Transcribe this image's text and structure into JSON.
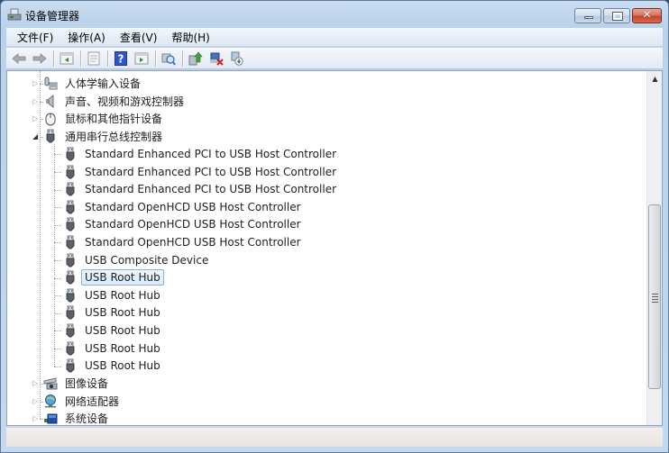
{
  "window": {
    "title": "设备管理器",
    "icon": "device-manager-icon",
    "controls": {
      "minimize": "minimize",
      "maximize": "maximize",
      "close": "✕"
    }
  },
  "menubar": {
    "items": [
      {
        "label": "文件(F)"
      },
      {
        "label": "操作(A)"
      },
      {
        "label": "查看(V)"
      },
      {
        "label": "帮助(H)"
      }
    ]
  },
  "toolbar": {
    "buttons": [
      {
        "icon": "back-arrow-icon"
      },
      {
        "icon": "forward-arrow-icon"
      },
      {
        "icon": "show-hide-console-tree-icon"
      },
      {
        "icon": "properties-icon"
      },
      {
        "icon": "help-icon"
      },
      {
        "icon": "show-hide-action-pane-icon"
      },
      {
        "icon": "scan-hardware-changes-icon"
      },
      {
        "icon": "update-driver-icon"
      },
      {
        "icon": "uninstall-device-icon"
      },
      {
        "icon": "disable-device-icon"
      }
    ]
  },
  "tree": {
    "nodes": [
      {
        "label": "人体学输入设备",
        "icon": "hid-icon",
        "expanded": false,
        "level": 0
      },
      {
        "label": "声音、视频和游戏控制器",
        "icon": "speaker-icon",
        "expanded": false,
        "level": 0
      },
      {
        "label": "鼠标和其他指针设备",
        "icon": "mouse-icon",
        "expanded": false,
        "level": 0
      },
      {
        "label": "通用串行总线控制器",
        "icon": "usb-icon",
        "expanded": true,
        "level": 0
      },
      {
        "label": "Standard Enhanced PCI to USB Host Controller",
        "icon": "usb-icon",
        "level": 1
      },
      {
        "label": "Standard Enhanced PCI to USB Host Controller",
        "icon": "usb-icon",
        "level": 1
      },
      {
        "label": "Standard Enhanced PCI to USB Host Controller",
        "icon": "usb-icon",
        "level": 1
      },
      {
        "label": "Standard OpenHCD USB Host Controller",
        "icon": "usb-icon",
        "level": 1
      },
      {
        "label": "Standard OpenHCD USB Host Controller",
        "icon": "usb-icon",
        "level": 1
      },
      {
        "label": "Standard OpenHCD USB Host Controller",
        "icon": "usb-icon",
        "level": 1
      },
      {
        "label": "USB Composite Device",
        "icon": "usb-icon",
        "level": 1
      },
      {
        "label": "USB Root Hub",
        "icon": "usb-icon",
        "level": 1,
        "selected": true
      },
      {
        "label": "USB Root Hub",
        "icon": "usb-icon",
        "level": 1
      },
      {
        "label": "USB Root Hub",
        "icon": "usb-icon",
        "level": 1
      },
      {
        "label": "USB Root Hub",
        "icon": "usb-icon",
        "level": 1
      },
      {
        "label": "USB Root Hub",
        "icon": "usb-icon",
        "level": 1
      },
      {
        "label": "USB Root Hub",
        "icon": "usb-icon",
        "level": 1
      },
      {
        "label": "图像设备",
        "icon": "imaging-device-icon",
        "expanded": false,
        "level": 0
      },
      {
        "label": "网络适配器",
        "icon": "network-adapter-icon",
        "expanded": false,
        "level": 0
      },
      {
        "label": "系统设备",
        "icon": "system-device-icon",
        "expanded": false,
        "level": 0
      }
    ]
  },
  "scrollbar": {
    "position": 0.55
  }
}
